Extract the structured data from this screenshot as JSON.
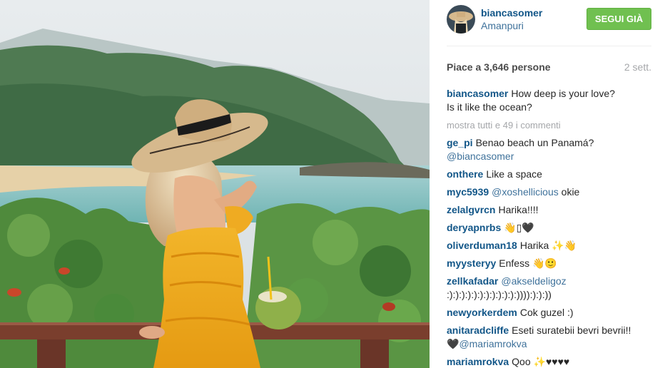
{
  "post": {
    "username": "biancasomer",
    "location": "Amanpuri",
    "follow_label": "SEGUI GIÀ",
    "likes_label": "Piace a 3,646 persone",
    "time_label": "2 sett."
  },
  "caption": {
    "user": "biancasomer",
    "text_line1": "How deep is your love?",
    "text_line2": "Is it like the ocean?"
  },
  "show_all_label": "mostra tutti e 49 i commenti",
  "comments": [
    {
      "user": "ge_pi",
      "text": "Benao beach un Panamá?",
      "mention": "@biancasomer"
    },
    {
      "user": "onthere",
      "text": "Like a space"
    },
    {
      "user": "myc5939",
      "mention": "@xoshellicious",
      "text": "okie"
    },
    {
      "user": "zelalgvrcn",
      "text": "Harika!!!!"
    },
    {
      "user": "deryapnrbs",
      "text": "👋▯🖤"
    },
    {
      "user": "oliverduman18",
      "text": "Harika ✨👋"
    },
    {
      "user": "myysteryy",
      "text": "Enfess 👋🙂"
    },
    {
      "user": "zellkafadar",
      "mention": "@akseldeligoz",
      "text2": ":):):):):):):):):):):):)))):):):))"
    },
    {
      "user": "newyorkerdem",
      "text": "Cok guzel :)"
    },
    {
      "user": "anitaradcliffe",
      "text": "Eseti suratebii bevri bevrii!!",
      "text2": "🖤",
      "mention2": "@mariamrokva"
    },
    {
      "user": "mariamrokva",
      "text": "Qoo ✨♥♥♥♥"
    }
  ],
  "colors": {
    "username_blue": "#125688",
    "mention_blue": "#3f729b",
    "follow_green": "#70c050",
    "meta_grey": "#a5a7aa"
  },
  "icons": [
    "avatar-photo",
    "post-photo"
  ]
}
